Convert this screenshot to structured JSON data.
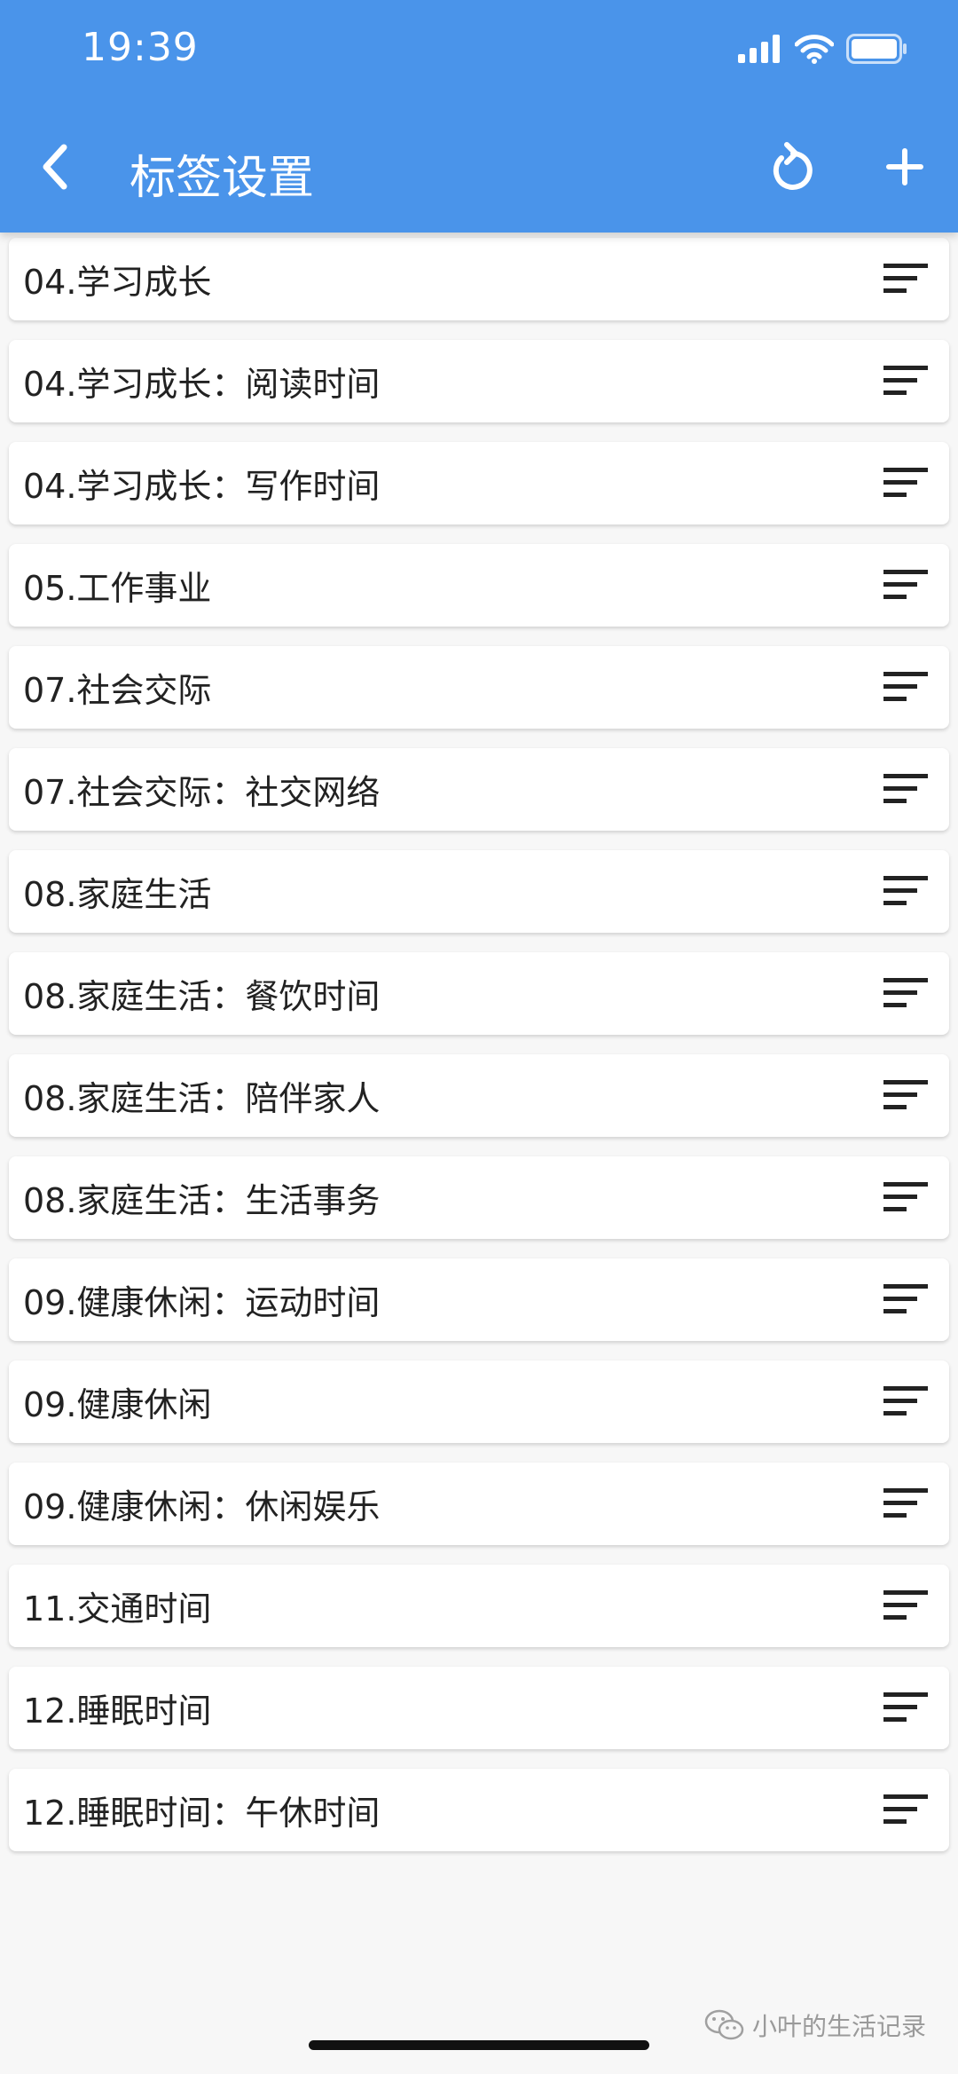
{
  "status_bar": {
    "time": "19:39",
    "icons": [
      "signal-icon",
      "wifi-icon",
      "battery-icon"
    ]
  },
  "header": {
    "title": "标签设置",
    "back_icon": "chevron-left-icon",
    "refresh_icon": "refresh-icon",
    "add_icon": "plus-icon",
    "background_color": "#4a94ea"
  },
  "tags": [
    {
      "label": "04.学习成长"
    },
    {
      "label": "04.学习成长：阅读时间"
    },
    {
      "label": "04.学习成长：写作时间"
    },
    {
      "label": "05.工作事业"
    },
    {
      "label": "07.社会交际"
    },
    {
      "label": "07.社会交际：社交网络"
    },
    {
      "label": "08.家庭生活"
    },
    {
      "label": "08.家庭生活：餐饮时间"
    },
    {
      "label": "08.家庭生活：陪伴家人"
    },
    {
      "label": "08.家庭生活：生活事务"
    },
    {
      "label": "09.健康休闲：运动时间"
    },
    {
      "label": "09.健康休闲"
    },
    {
      "label": "09.健康休闲：休闲娱乐"
    },
    {
      "label": "11.交通时间"
    },
    {
      "label": "12.睡眠时间"
    },
    {
      "label": "12.睡眠时间：午休时间"
    }
  ],
  "watermark": {
    "text": "小叶的生活记录",
    "icon": "wechat-icon"
  }
}
